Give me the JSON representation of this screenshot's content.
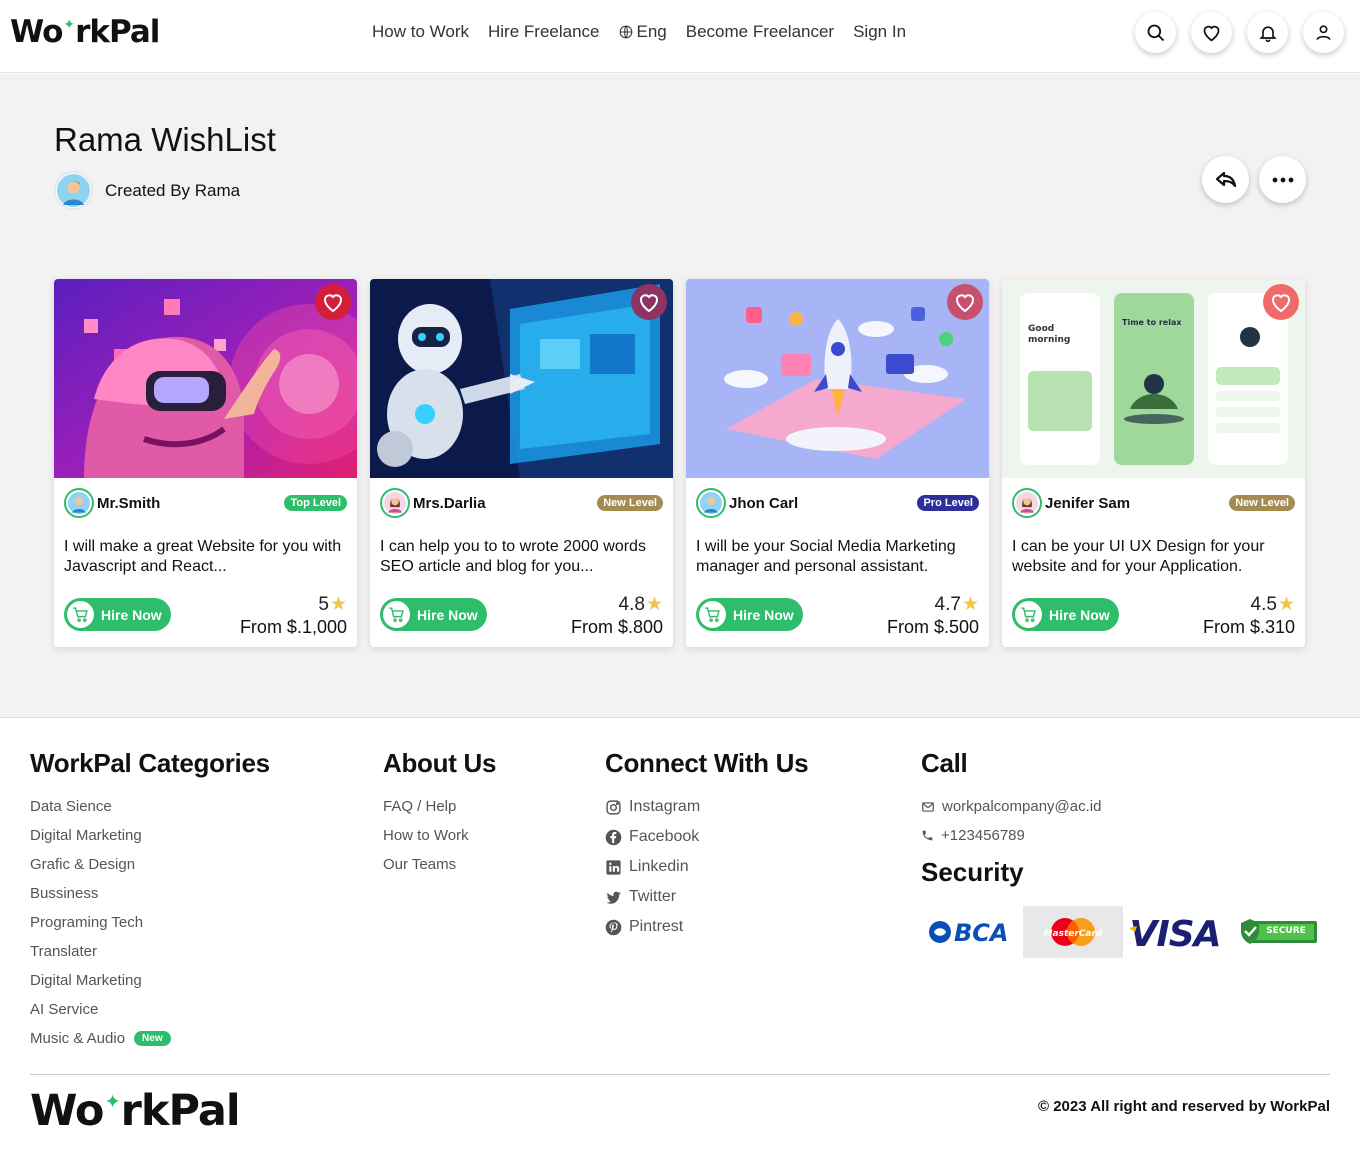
{
  "header": {
    "logo_left": "Wo",
    "logo_right": "rkPal",
    "nav": {
      "how_to_work": "How to Work",
      "hire_freelance": "Hire Freelance",
      "language": "Eng",
      "become_freelancer": "Become Freelancer",
      "sign_in": "Sign In"
    }
  },
  "wishlist": {
    "title": "Rama WishList",
    "created_by": "Created By Rama"
  },
  "cards": [
    {
      "name": "Mr.Smith",
      "level": "Top Level",
      "level_color": "#2ebd6a",
      "description": "I will make a great Website for you with Javascript and React...",
      "hire_label": "Hire Now",
      "rating": "5",
      "price": "From $.1,000"
    },
    {
      "name": "Mrs.Darlia",
      "level": "New Level",
      "level_color": "#a58a52",
      "description": "I can help you to to wrote 2000 words SEO article and blog for you...",
      "hire_label": "Hire Now",
      "rating": "4.8",
      "price": "From $.800"
    },
    {
      "name": "Jhon Carl",
      "level": "Pro Level",
      "level_color": "#2f2f9a",
      "description": "I will be your Social Media Marketing manager and personal assistant.",
      "hire_label": "Hire Now",
      "rating": "4.7",
      "price": "From $.500"
    },
    {
      "name": "Jenifer Sam",
      "level": "New Level",
      "level_color": "#a58a52",
      "description": "I can be your UI UX Design for your website and for your Application.",
      "hire_label": "Hire Now",
      "rating": "4.5",
      "price": "From $.310"
    }
  ],
  "footer": {
    "categories": {
      "title": "WorkPal Categories",
      "items": [
        "Data Sience",
        "Digital Marketing",
        "Grafic & Design",
        "Bussiness",
        "Programing Tech",
        "Translater",
        "Digital Marketing",
        "AI Service",
        "Music & Audio"
      ],
      "new_badge": "New"
    },
    "about": {
      "title": "About Us",
      "items": [
        "FAQ / Help",
        "How to Work",
        "Our Teams"
      ]
    },
    "connect": {
      "title": "Connect With Us",
      "items": [
        "Instagram",
        "Facebook",
        "Linkedin",
        "Twitter",
        "Pintrest"
      ]
    },
    "call": {
      "title": "Call",
      "email": "workpalcompany@ac.id",
      "phone": "+123456789"
    },
    "security": {
      "title": "Security",
      "logos": [
        "BCA",
        "MasterCard",
        "VISA",
        "SECURE"
      ]
    },
    "copyright": "© 2023 All right and reserved by WorkPal"
  },
  "colors": {
    "accent_green": "#2ebd6a",
    "heart_red": "#e5364a",
    "page_bg": "#f3f2f2"
  }
}
